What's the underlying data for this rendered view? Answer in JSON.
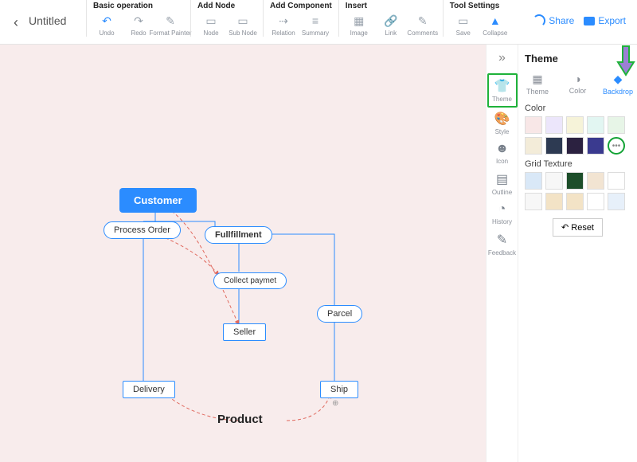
{
  "title": "Untitled",
  "toolbar_groups": [
    {
      "title": "Basic operation",
      "items": [
        {
          "label": "Undo",
          "icon": "↶",
          "blue": true
        },
        {
          "label": "Redo",
          "icon": "↷"
        },
        {
          "label": "Format Painter",
          "icon": "✎"
        }
      ]
    },
    {
      "title": "Add Node",
      "items": [
        {
          "label": "Node",
          "icon": "▭"
        },
        {
          "label": "Sub Node",
          "icon": "▭"
        }
      ]
    },
    {
      "title": "Add Component",
      "items": [
        {
          "label": "Relation",
          "icon": "⇢"
        },
        {
          "label": "Summary",
          "icon": "≡"
        }
      ]
    },
    {
      "title": "Insert",
      "items": [
        {
          "label": "Image",
          "icon": "▦"
        },
        {
          "label": "Link",
          "icon": "🔗"
        },
        {
          "label": "Comments",
          "icon": "✎"
        }
      ]
    },
    {
      "title": "Tool Settings",
      "items": [
        {
          "label": "Save",
          "icon": "▭"
        },
        {
          "label": "Collapse",
          "icon": "▲",
          "blue": true
        }
      ]
    }
  ],
  "share": "Share",
  "export": "Export",
  "side": [
    {
      "label": "Theme",
      "icon": "👕",
      "active": true
    },
    {
      "label": "Style",
      "icon": "🎨"
    },
    {
      "label": "Icon",
      "icon": "☻"
    },
    {
      "label": "Outline",
      "icon": "▤"
    },
    {
      "label": "History",
      "icon": "◔"
    },
    {
      "label": "Feedback",
      "icon": "✎"
    }
  ],
  "panel": {
    "title": "Theme",
    "tabs": [
      {
        "label": "Theme",
        "icon": "▦"
      },
      {
        "label": "Color",
        "icon": "◑"
      },
      {
        "label": "Backdrop",
        "icon": "◆",
        "active": true
      }
    ],
    "color_label": "Color",
    "texture_label": "Grid Texture",
    "reset": "↶ Reset",
    "colors_row1": [
      "#f8e7e7",
      "#ece6fb",
      "#f6f3d9",
      "#e2f6f2",
      "#e7f5e7"
    ],
    "colors_row2": [
      "#f3ecd9",
      "#2d3a52",
      "#2b2140",
      "#3a3a8f",
      "more"
    ],
    "textures_row1": [
      "#d9e8f7",
      "#f7f7f7",
      "#1d4e2a",
      "#f2e4d2",
      "#ffffff"
    ],
    "textures_row2": [
      "#f7f7f7",
      "#f3e3c6",
      "#f3e3c6",
      "#ffffff",
      "#e7f0fa"
    ]
  },
  "diagram": {
    "customer": "Customer",
    "process_order": "Process Order",
    "fullfillment": "Fullfillment",
    "collect_payment": "Collect paymet",
    "seller": "Seller",
    "parcel": "Parcel",
    "delivery": "Delivery",
    "ship": "Ship",
    "product": "Product"
  },
  "chart_data": {
    "type": "flowchart",
    "nodes": [
      {
        "id": "customer",
        "label": "Customer",
        "kind": "root"
      },
      {
        "id": "process_order",
        "label": "Process Order",
        "kind": "pill"
      },
      {
        "id": "fullfillment",
        "label": "Fullfillment",
        "kind": "pill-bold"
      },
      {
        "id": "collect_payment",
        "label": "Collect paymet",
        "kind": "pill"
      },
      {
        "id": "seller",
        "label": "Seller",
        "kind": "rect"
      },
      {
        "id": "parcel",
        "label": "Parcel",
        "kind": "pill"
      },
      {
        "id": "delivery",
        "label": "Delivery",
        "kind": "rect"
      },
      {
        "id": "ship",
        "label": "Ship",
        "kind": "rect"
      },
      {
        "id": "product",
        "label": "Product",
        "kind": "text"
      }
    ],
    "solid_edges": [
      [
        "customer",
        "process_order"
      ],
      [
        "customer",
        "fullfillment"
      ],
      [
        "process_order",
        "delivery"
      ],
      [
        "fullfillment",
        "collect_payment"
      ],
      [
        "fullfillment",
        "parcel"
      ],
      [
        "collect_payment",
        "seller"
      ],
      [
        "parcel",
        "ship"
      ]
    ],
    "dashed_edges": [
      [
        "customer",
        "seller"
      ],
      [
        "process_order",
        "collect_payment"
      ],
      [
        "delivery",
        "product"
      ],
      [
        "product",
        "ship"
      ]
    ]
  }
}
